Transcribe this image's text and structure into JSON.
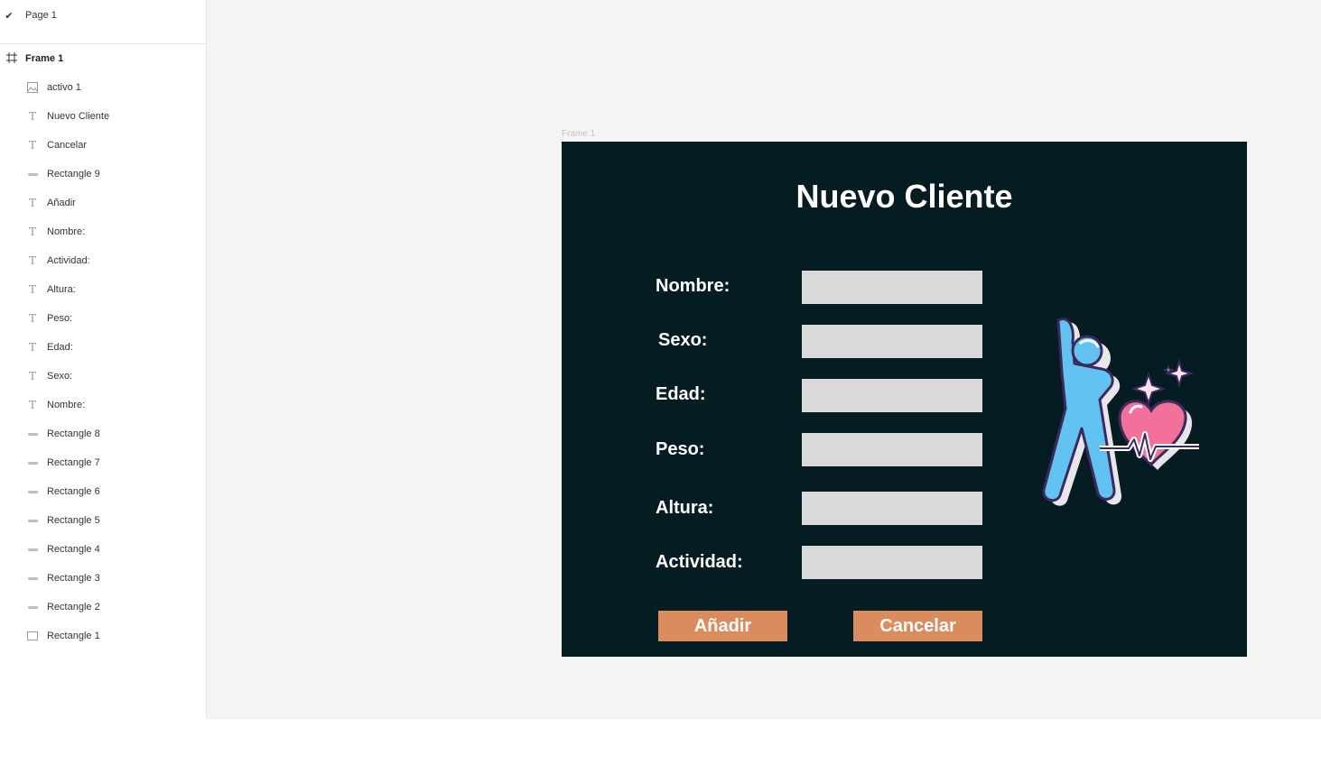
{
  "sidebar": {
    "page": {
      "label": "Page 1",
      "icon": "check-icon"
    },
    "frame": {
      "label": "Frame 1",
      "icon": "frame-grid-icon"
    },
    "layers": [
      {
        "label": "activo 1",
        "icon": "image-icon"
      },
      {
        "label": "Nuevo Cliente",
        "icon": "text-icon"
      },
      {
        "label": "Cancelar",
        "icon": "text-icon"
      },
      {
        "label": "Rectangle 9",
        "icon": "rectangle-line-icon"
      },
      {
        "label": "Añadir",
        "icon": "text-icon"
      },
      {
        "label": "Nombre:",
        "icon": "text-icon"
      },
      {
        "label": "Actividad:",
        "icon": "text-icon"
      },
      {
        "label": "Altura:",
        "icon": "text-icon"
      },
      {
        "label": "Peso:",
        "icon": "text-icon"
      },
      {
        "label": "Edad:",
        "icon": "text-icon"
      },
      {
        "label": "Sexo:",
        "icon": "text-icon"
      },
      {
        "label": "Nombre:",
        "icon": "text-icon"
      },
      {
        "label": "Rectangle 8",
        "icon": "rectangle-line-icon"
      },
      {
        "label": "Rectangle 7",
        "icon": "rectangle-line-icon"
      },
      {
        "label": "Rectangle 6",
        "icon": "rectangle-line-icon"
      },
      {
        "label": "Rectangle 5",
        "icon": "rectangle-line-icon"
      },
      {
        "label": "Rectangle 4",
        "icon": "rectangle-line-icon"
      },
      {
        "label": "Rectangle 3",
        "icon": "rectangle-line-icon"
      },
      {
        "label": "Rectangle 2",
        "icon": "rectangle-line-icon"
      },
      {
        "label": "Rectangle 1",
        "icon": "rectangle-box-icon"
      }
    ]
  },
  "canvas": {
    "frame_title": "Frame 1",
    "colors": {
      "canvas_bg": "#f4f4f4",
      "frame_bg": "#061c23",
      "input_bg": "#d9d9d9",
      "button_bg": "#db8c5e",
      "text": "#ffffff"
    }
  },
  "form": {
    "title": "Nuevo Cliente",
    "fields": [
      {
        "label": "Nombre:",
        "value": ""
      },
      {
        "label": "Sexo:",
        "value": ""
      },
      {
        "label": "Edad:",
        "value": ""
      },
      {
        "label": "Peso:",
        "value": ""
      },
      {
        "label": "Altura:",
        "value": ""
      },
      {
        "label": "Actividad:",
        "value": ""
      }
    ],
    "add_button": "Añadir",
    "cancel_button": "Cancelar",
    "illustration": "fitness-heart-illustration"
  }
}
